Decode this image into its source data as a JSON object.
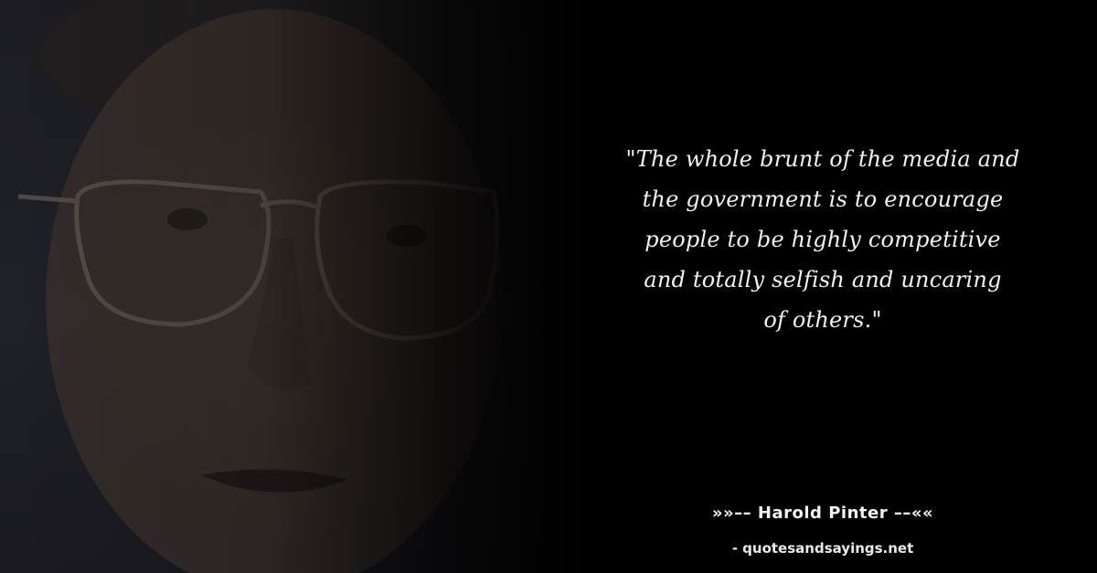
{
  "quote": {
    "text": "\"The whole brunt of the media and\nthe government is to encourage\npeople to be highly competitive\nand totally selfish and uncaring\nof others.\""
  },
  "attribution": {
    "author_line": "»»–– Harold Pinter ––««",
    "source": "- quotesandsayings.net"
  },
  "colors": {
    "background": "#000000",
    "text": "#f2f2f2"
  }
}
